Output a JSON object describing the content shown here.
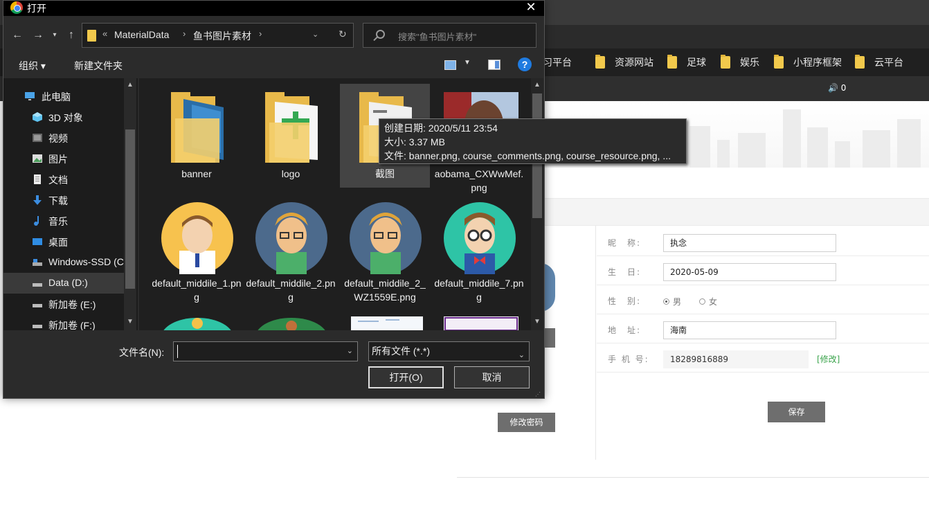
{
  "bookmarks": [
    "学习平台",
    "资源网站",
    "足球",
    "娱乐",
    "小程序框架",
    "云平台"
  ],
  "volume_label": "🔊 0",
  "profile_form": {
    "nickname_label": "昵　称:",
    "nickname_value": "执念",
    "birthday_label": "生　日:",
    "birthday_value": "2020-05-09",
    "gender_label": "性　别:",
    "gender_male": "男",
    "gender_female": "女",
    "address_label": "地　址:",
    "address_value": "海南",
    "phone_label": "手 机 号:",
    "phone_value": "18289816889",
    "modify_link": "[修改]",
    "save_button": "保存",
    "change_password_button": "修改密码"
  },
  "dialog": {
    "title": "打开",
    "breadcrumb": {
      "prefix": "«",
      "parent": "MaterialData",
      "current": "鱼书图片素材"
    },
    "search_placeholder": "搜索\"鱼书图片素材\"",
    "toolbar": {
      "organize": "组织 ▾",
      "new_folder": "新建文件夹"
    },
    "sidebar": [
      {
        "label": "此电脑",
        "icon": "computer-icon"
      },
      {
        "label": "3D 对象",
        "icon": "cube-icon"
      },
      {
        "label": "视频",
        "icon": "video-icon"
      },
      {
        "label": "图片",
        "icon": "pictures-icon"
      },
      {
        "label": "文档",
        "icon": "document-icon"
      },
      {
        "label": "下载",
        "icon": "download-icon"
      },
      {
        "label": "音乐",
        "icon": "music-icon"
      },
      {
        "label": "桌面",
        "icon": "desktop-icon"
      },
      {
        "label": "Windows-SSD (C",
        "icon": "drive-icon"
      },
      {
        "label": "Data (D:)",
        "icon": "drive-icon"
      },
      {
        "label": "新加卷 (E:)",
        "icon": "drive-icon"
      },
      {
        "label": "新加卷 (F:)",
        "icon": "drive-icon"
      }
    ],
    "files": [
      {
        "label": "banner",
        "type": "folder"
      },
      {
        "label": "logo",
        "type": "folder"
      },
      {
        "label": "截图",
        "type": "folder"
      },
      {
        "label": "aobama_CXWwMef.png",
        "type": "photo"
      },
      {
        "label": "default_middile_1.png",
        "type": "avatar"
      },
      {
        "label": "default_middile_2.png",
        "type": "avatar"
      },
      {
        "label": "default_middile_2_WZ1559E.png",
        "type": "avatar"
      },
      {
        "label": "default_middile_7.png",
        "type": "avatar"
      }
    ],
    "tooltip": {
      "created": "创建日期: 2020/5/11 23:54",
      "size": "大小: 3.37 MB",
      "files": "文件: banner.png, course_comments.png, course_resource.png, ..."
    },
    "filename_label": "文件名(N):",
    "filename_value": "",
    "filetype_value": "所有文件 (*.*)",
    "open_button": "打开(O)",
    "cancel_button": "取消"
  }
}
